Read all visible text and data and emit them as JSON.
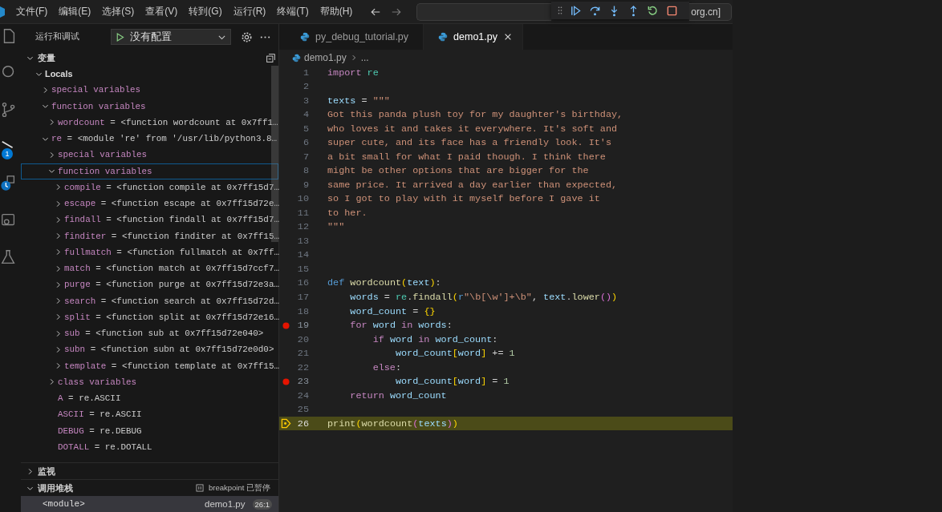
{
  "menu": [
    "文件(F)",
    "编辑(E)",
    "选择(S)",
    "查看(V)",
    "转到(G)",
    "运行(R)",
    "终端(T)",
    "帮助(H)"
  ],
  "command_center": {
    "text": "org.cn]"
  },
  "activity_bar": {
    "debug_badge": "1"
  },
  "sidebar": {
    "title": "运行和调试",
    "config": "没有配置",
    "variables": {
      "title": "变量",
      "expanded": true,
      "tree": [
        {
          "name": "Locals",
          "kind": "scope",
          "expanded": true,
          "selected": false,
          "children": [
            {
              "name": "special variables",
              "kind": "group",
              "expanded": false,
              "selected": false
            },
            {
              "name": "function variables",
              "kind": "group",
              "expanded": true,
              "selected": false,
              "children": [
                {
                  "name": "wordcount",
                  "value": "= <function wordcount at 0x7ff1…",
                  "kind": "var",
                  "expanded": false,
                  "selected": false
                }
              ]
            },
            {
              "name": "re",
              "value": "= <module 're' from '/usr/lib/python3.8…",
              "kind": "var",
              "expanded": true,
              "selected": false,
              "children": [
                {
                  "name": "special variables",
                  "kind": "group",
                  "expanded": false,
                  "selected": false
                },
                {
                  "name": "function variables",
                  "kind": "group",
                  "expanded": true,
                  "selected": true,
                  "children": [
                    {
                      "name": "compile",
                      "value": "= <function compile at 0x7ff15d7…",
                      "kind": "var",
                      "expanded": false,
                      "selected": false
                    },
                    {
                      "name": "escape",
                      "value": "= <function escape at 0x7ff15d72e…",
                      "kind": "var",
                      "expanded": false,
                      "selected": false
                    },
                    {
                      "name": "findall",
                      "value": "= <function findall at 0x7ff15d7…",
                      "kind": "var",
                      "expanded": false,
                      "selected": false
                    },
                    {
                      "name": "finditer",
                      "value": "= <function finditer at 0x7ff15…",
                      "kind": "var",
                      "expanded": false,
                      "selected": false
                    },
                    {
                      "name": "fullmatch",
                      "value": "= <function fullmatch at 0x7ff…",
                      "kind": "var",
                      "expanded": false,
                      "selected": false
                    },
                    {
                      "name": "match",
                      "value": "= <function match at 0x7ff15d7ccf7…",
                      "kind": "var",
                      "expanded": false,
                      "selected": false
                    },
                    {
                      "name": "purge",
                      "value": "= <function purge at 0x7ff15d72e3a…",
                      "kind": "var",
                      "expanded": false,
                      "selected": false
                    },
                    {
                      "name": "search",
                      "value": "= <function search at 0x7ff15d72d…",
                      "kind": "var",
                      "expanded": false,
                      "selected": false
                    },
                    {
                      "name": "split",
                      "value": "= <function split at 0x7ff15d72e16…",
                      "kind": "var",
                      "expanded": false,
                      "selected": false
                    },
                    {
                      "name": "sub",
                      "value": "= <function sub at 0x7ff15d72e040>",
                      "kind": "var",
                      "expanded": false,
                      "selected": false
                    },
                    {
                      "name": "subn",
                      "value": "= <function subn at 0x7ff15d72e0d0>",
                      "kind": "var",
                      "expanded": false,
                      "selected": false
                    },
                    {
                      "name": "template",
                      "value": "= <function template at 0x7ff15…",
                      "kind": "var",
                      "expanded": false,
                      "selected": false
                    }
                  ]
                },
                {
                  "name": "class variables",
                  "kind": "group",
                  "expanded": false,
                  "selected": false
                },
                {
                  "name": "A",
                  "value": "= re.ASCII",
                  "kind": "var",
                  "selected": false
                },
                {
                  "name": "ASCII",
                  "value": "= re.ASCII",
                  "kind": "var",
                  "selected": false
                },
                {
                  "name": "DEBUG",
                  "value": "= re.DEBUG",
                  "kind": "var",
                  "selected": false
                },
                {
                  "name": "DOTALL",
                  "value": "= re.DOTALL",
                  "kind": "var",
                  "selected": false
                }
              ]
            }
          ]
        }
      ]
    },
    "watch": {
      "title": "监视",
      "expanded": false
    },
    "call_stack": {
      "title": "调用堆栈",
      "expanded": true,
      "status": "breakpoint 已暂停",
      "frames": [
        {
          "name": "<module>",
          "file": "demo1.py",
          "position": "26:1",
          "selected": true
        }
      ]
    }
  },
  "tabs": [
    {
      "label": "py_debug_tutorial.py",
      "selected": false
    },
    {
      "label": "demo1.py",
      "selected": true
    }
  ],
  "breadcrumb": [
    "demo1.py",
    "..."
  ],
  "code_lines": [
    {
      "n": "1",
      "breakpoint": false,
      "current": false,
      "tokens": [
        {
          "kind": "kw",
          "text": "import"
        },
        {
          "kind": "mod",
          "text": " re"
        }
      ]
    },
    {
      "n": "2",
      "breakpoint": false,
      "current": false
    },
    {
      "n": "3",
      "breakpoint": false,
      "current": false,
      "tokens": [
        {
          "kind": "var",
          "text": "texts"
        },
        {
          "kind": "op",
          "text": " = "
        },
        {
          "kind": "str",
          "text": "\"\"\""
        }
      ]
    },
    {
      "n": "4",
      "breakpoint": false,
      "current": false,
      "tokens": [
        {
          "kind": "str",
          "text": "Got this panda plush toy for my daughter's birthday,"
        }
      ]
    },
    {
      "n": "5",
      "breakpoint": false,
      "current": false,
      "tokens": [
        {
          "kind": "str",
          "text": "who loves it and takes it everywhere. It's soft and"
        }
      ]
    },
    {
      "n": "6",
      "breakpoint": false,
      "current": false,
      "tokens": [
        {
          "kind": "str",
          "text": "super cute, and its face has a friendly look. It's"
        }
      ]
    },
    {
      "n": "7",
      "breakpoint": false,
      "current": false,
      "tokens": [
        {
          "kind": "str",
          "text": "a bit small for what I paid though. I think there"
        }
      ]
    },
    {
      "n": "8",
      "breakpoint": false,
      "current": false,
      "tokens": [
        {
          "kind": "str",
          "text": "might be other options that are bigger for the"
        }
      ]
    },
    {
      "n": "9",
      "breakpoint": false,
      "current": false,
      "tokens": [
        {
          "kind": "str",
          "text": "same price. It arrived a day earlier than expected,"
        }
      ]
    },
    {
      "n": "10",
      "breakpoint": false,
      "current": false,
      "tokens": [
        {
          "kind": "str",
          "text": "so I got to play with it myself before I gave it"
        }
      ]
    },
    {
      "n": "11",
      "breakpoint": false,
      "current": false,
      "tokens": [
        {
          "kind": "str",
          "text": "to her."
        }
      ]
    },
    {
      "n": "12",
      "breakpoint": false,
      "current": false,
      "tokens": [
        {
          "kind": "str",
          "text": "\"\"\""
        }
      ]
    },
    {
      "n": "13",
      "breakpoint": false,
      "current": false
    },
    {
      "n": "14",
      "breakpoint": false,
      "current": false
    },
    {
      "n": "15",
      "breakpoint": false,
      "current": false
    },
    {
      "n": "16",
      "breakpoint": false,
      "current": false,
      "tokens": [
        {
          "kind": "def",
          "text": "def"
        },
        {
          "kind": "fn",
          "text": " wordcount"
        },
        {
          "kind": "b1",
          "text": "("
        },
        {
          "kind": "var",
          "text": "text"
        },
        {
          "kind": "b1",
          "text": ")"
        },
        {
          "kind": "op",
          "text": ":"
        }
      ]
    },
    {
      "n": "17",
      "breakpoint": false,
      "current": false,
      "tokens": [
        {
          "kind": "var",
          "text": "    words"
        },
        {
          "kind": "op",
          "text": " = "
        },
        {
          "kind": "mod",
          "text": "re"
        },
        {
          "kind": "op",
          "text": "."
        },
        {
          "kind": "fn",
          "text": "findall"
        },
        {
          "kind": "b1",
          "text": "("
        },
        {
          "kind": "def",
          "text": "r"
        },
        {
          "kind": "str",
          "text": "\"\\b[\\w']+\\b\""
        },
        {
          "kind": "op",
          "text": ", "
        },
        {
          "kind": "var",
          "text": "text"
        },
        {
          "kind": "op",
          "text": "."
        },
        {
          "kind": "fn",
          "text": "lower"
        },
        {
          "kind": "b2",
          "text": "()"
        },
        {
          "kind": "b1",
          "text": ")"
        }
      ]
    },
    {
      "n": "18",
      "breakpoint": false,
      "current": false,
      "tokens": [
        {
          "kind": "var",
          "text": "    word_count"
        },
        {
          "kind": "op",
          "text": " = "
        },
        {
          "kind": "b1",
          "text": "{}"
        }
      ]
    },
    {
      "n": "19",
      "breakpoint": true,
      "current": false,
      "tokens": [
        {
          "kind": "kw",
          "text": "    for"
        },
        {
          "kind": "var",
          "text": " word"
        },
        {
          "kind": "kw",
          "text": " in"
        },
        {
          "kind": "var",
          "text": " words"
        },
        {
          "kind": "op",
          "text": ":"
        }
      ]
    },
    {
      "n": "20",
      "breakpoint": false,
      "current": false,
      "tokens": [
        {
          "kind": "kw",
          "text": "        if"
        },
        {
          "kind": "var",
          "text": " word"
        },
        {
          "kind": "kw",
          "text": " in"
        },
        {
          "kind": "var",
          "text": " word_count"
        },
        {
          "kind": "op",
          "text": ":"
        }
      ]
    },
    {
      "n": "21",
      "breakpoint": false,
      "current": false,
      "tokens": [
        {
          "kind": "var",
          "text": "            word_count"
        },
        {
          "kind": "b1",
          "text": "["
        },
        {
          "kind": "var",
          "text": "word"
        },
        {
          "kind": "b1",
          "text": "]"
        },
        {
          "kind": "op",
          "text": " += "
        },
        {
          "kind": "num",
          "text": "1"
        }
      ]
    },
    {
      "n": "22",
      "breakpoint": false,
      "current": false,
      "tokens": [
        {
          "kind": "kw",
          "text": "        else"
        },
        {
          "kind": "op",
          "text": ":"
        }
      ]
    },
    {
      "n": "23",
      "breakpoint": true,
      "current": false,
      "tokens": [
        {
          "kind": "var",
          "text": "            word_count"
        },
        {
          "kind": "b1",
          "text": "["
        },
        {
          "kind": "var",
          "text": "word"
        },
        {
          "kind": "b1",
          "text": "]"
        },
        {
          "kind": "op",
          "text": " = "
        },
        {
          "kind": "num",
          "text": "1"
        }
      ]
    },
    {
      "n": "24",
      "breakpoint": false,
      "current": false,
      "tokens": [
        {
          "kind": "kw",
          "text": "    return"
        },
        {
          "kind": "var",
          "text": " word_count"
        }
      ]
    },
    {
      "n": "25",
      "breakpoint": false,
      "current": false
    },
    {
      "n": "26",
      "breakpoint": false,
      "current": true,
      "tokens": [
        {
          "kind": "fn",
          "text": "print"
        },
        {
          "kind": "b1",
          "text": "("
        },
        {
          "kind": "fn",
          "text": "wordcount"
        },
        {
          "kind": "b2",
          "text": "("
        },
        {
          "kind": "var",
          "text": "texts"
        },
        {
          "kind": "b2",
          "text": ")"
        },
        {
          "kind": "b1",
          "text": ")"
        }
      ]
    }
  ]
}
